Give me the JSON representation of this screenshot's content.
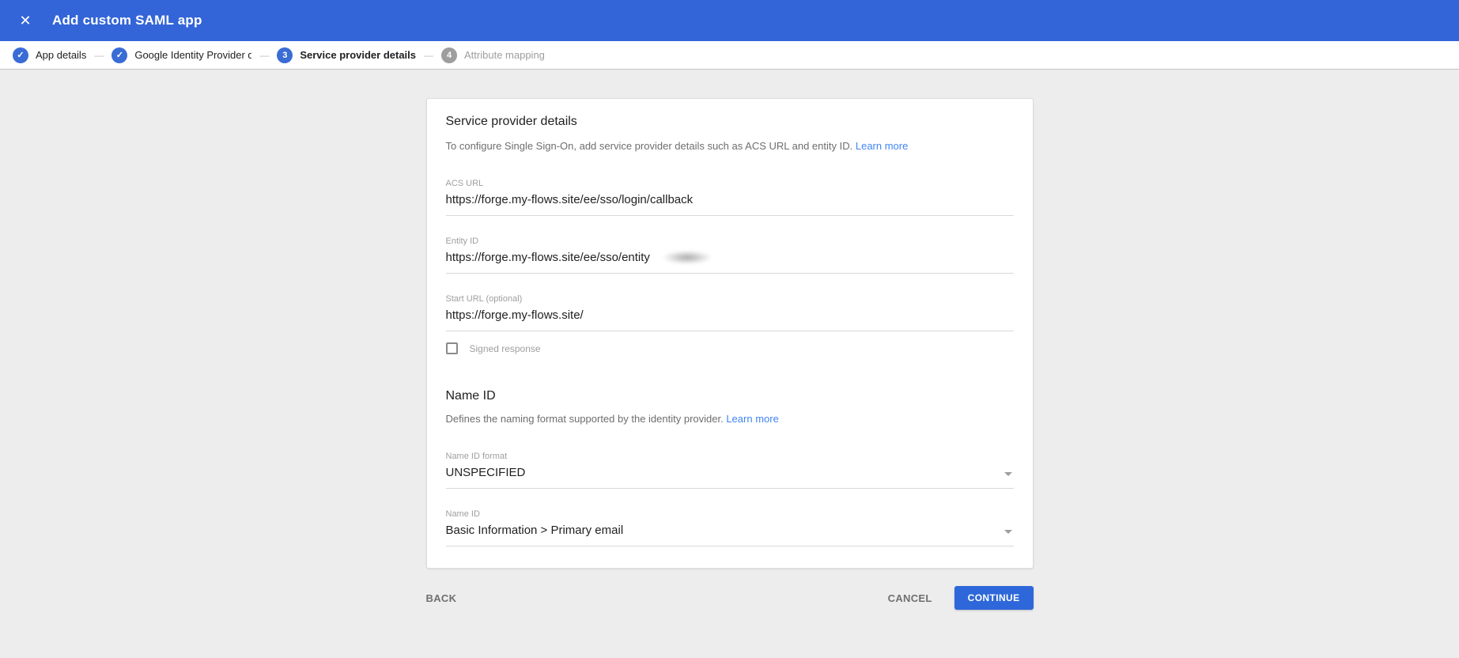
{
  "icons": {
    "close": "✕",
    "check": "✓"
  },
  "colors": {
    "appbar_bg": "#3365d8",
    "step_active_blue": "#3a6cd6",
    "step_inactive_gray": "#9e9e9e",
    "link_blue": "#4285f4",
    "continue_button_bg": "#2e67d9",
    "page_bg": "#ededed"
  },
  "header": {
    "title": "Add custom SAML app"
  },
  "stepper": {
    "separator": "—",
    "steps": [
      {
        "label": "App details",
        "state": "complete"
      },
      {
        "label": "Google Identity Provider details",
        "state": "complete"
      },
      {
        "label": "Service provider details",
        "state": "active",
        "number": "3"
      },
      {
        "label": "Attribute mapping",
        "state": "upcoming",
        "number": "4"
      }
    ]
  },
  "card": {
    "title": "Service provider details",
    "description": "To configure Single Sign-On, add service provider details such as ACS URL and entity ID.",
    "learn_more": "Learn more",
    "fields": {
      "acs_url": {
        "label": "ACS URL",
        "value": "https://forge.my-flows.site/ee/sso/login/callback"
      },
      "entity_id": {
        "label": "Entity ID",
        "value": "https://forge.my-flows.site/ee/sso/entity",
        "redacted": true
      },
      "start_url": {
        "label": "Start URL (optional)",
        "value": "https://forge.my-flows.site/"
      }
    },
    "signed_response": {
      "label": "Signed response",
      "checked": false
    },
    "name_id": {
      "title": "Name ID",
      "description": "Defines the naming format supported by the identity provider.",
      "learn_more": "Learn more",
      "format": {
        "label": "Name ID format",
        "value": "UNSPECIFIED"
      },
      "value_field": {
        "label": "Name ID",
        "value": "Basic Information > Primary email"
      }
    }
  },
  "actions": {
    "back": "BACK",
    "cancel": "CANCEL",
    "continue": "CONTINUE"
  }
}
